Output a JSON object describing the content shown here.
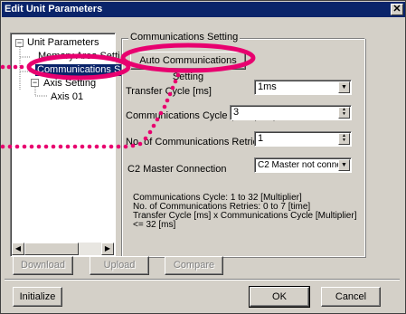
{
  "window": {
    "title": "Edit Unit Parameters",
    "close_glyph": "✕"
  },
  "tree": {
    "root_label": "Unit Parameters",
    "items": [
      {
        "label": "Memory Area Setti"
      },
      {
        "label": "Communications S",
        "selected": true
      },
      {
        "label": "Axis Setting"
      },
      {
        "label": "Axis 01"
      }
    ]
  },
  "group": {
    "title": "Communications Setting",
    "auto_button_label": "Auto Communications Setting"
  },
  "fields": {
    "transfer_cycle": {
      "label": "Transfer Cycle [ms]",
      "value": "1ms"
    },
    "comm_cycle": {
      "label": "Communications Cycle (Multiplier)",
      "value": "3"
    },
    "retries": {
      "label": "No. of Communications Retries",
      "value": "1"
    },
    "c2_master": {
      "label": "C2 Master Connection",
      "value": "C2 Master not connec"
    }
  },
  "notes": {
    "line1": "Communications Cycle: 1 to 32 [Multiplier]",
    "line2": "No. of Communications Retries: 0 to 7 [time]",
    "line3": "Transfer Cycle [ms] x Communications Cycle [Multiplier]",
    "line4": "<= 32 [ms]"
  },
  "buttons": {
    "download": "Download",
    "upload": "Upload",
    "compare": "Compare",
    "initialize": "Initialize",
    "ok": "OK",
    "cancel": "Cancel"
  },
  "colors": {
    "highlight_annotation": "#e8006f",
    "selection": "#0a246a",
    "dialog_face": "#d4d0c8"
  },
  "icons": {
    "tree_expander": "minus-box-icon",
    "combo": "chevron-down-icon",
    "spinner": "up-down-spin-icon"
  }
}
